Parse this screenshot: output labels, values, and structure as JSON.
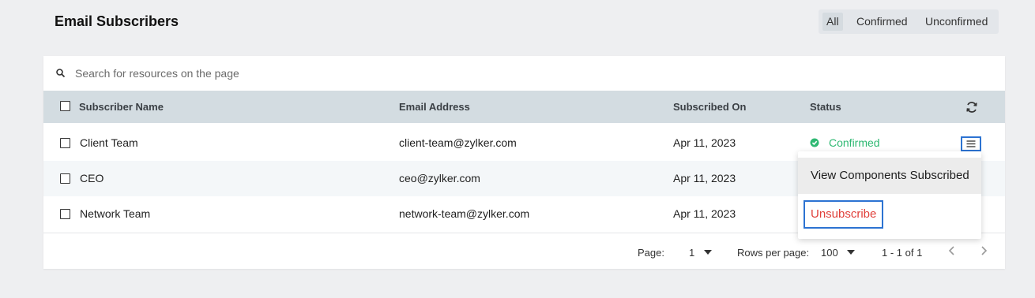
{
  "page": {
    "title": "Email Subscribers"
  },
  "filters": [
    {
      "label": "All",
      "active": true
    },
    {
      "label": "Confirmed",
      "active": false
    },
    {
      "label": "Unconfirmed",
      "active": false
    }
  ],
  "search": {
    "placeholder": "Search for resources on the page",
    "value": ""
  },
  "table": {
    "columns": [
      "Subscriber Name",
      "Email Address",
      "Subscribed On",
      "Status"
    ],
    "rows": [
      {
        "name": "Client Team",
        "email": "client-team@zylker.com",
        "date": "Apr 11, 2023",
        "status": "Confirmed"
      },
      {
        "name": "CEO",
        "email": "ceo@zylker.com",
        "date": "Apr 11, 2023",
        "status": ""
      },
      {
        "name": "Network Team",
        "email": "network-team@zylker.com",
        "date": "Apr 11, 2023",
        "status": ""
      }
    ]
  },
  "context_menu": {
    "items": [
      "View Components Subscribed",
      "Unsubscribe"
    ]
  },
  "pagination": {
    "page_label": "Page:",
    "page_value": "1",
    "rows_label": "Rows per page:",
    "rows_value": "100",
    "range": "1 - 1 of 1"
  },
  "colors": {
    "accent": "#2c73d2",
    "confirmed": "#2eb872",
    "danger": "#e0403a",
    "header_bg": "#d3dce1"
  },
  "icons": [
    "search-icon",
    "refresh-icon",
    "check-circle-icon",
    "menu-icon",
    "chevron-left-icon",
    "chevron-right-icon",
    "caret-down-icon"
  ]
}
